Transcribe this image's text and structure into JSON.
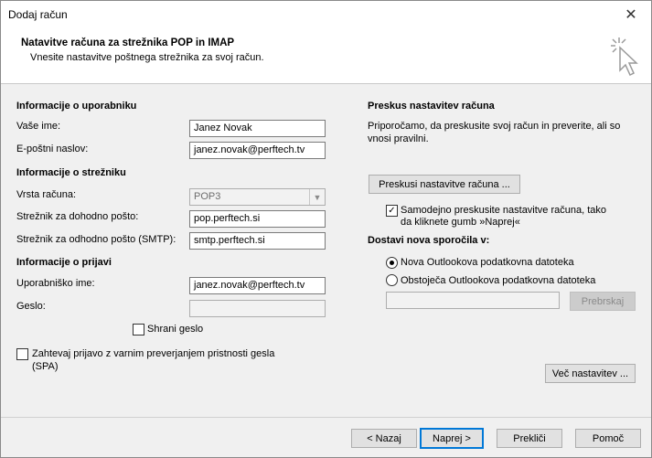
{
  "window": {
    "title": "Dodaj račun",
    "close_glyph": "✕"
  },
  "header": {
    "title": "Natavitve računa za strežnika POP in IMAP",
    "subtitle": "Vnesite nastavitve poštnega strežnika za svoj račun.",
    "icon": "wizard-cursor-icon"
  },
  "user_info": {
    "heading": "Informacije o uporabniku",
    "name_label": "Vaše ime:",
    "name_value": "Janez Novak",
    "email_label": "E-poštni naslov:",
    "email_value": "janez.novak@perftech.tv"
  },
  "server_info": {
    "heading": "Informacije o strežniku",
    "account_type_label": "Vrsta računa:",
    "account_type_value": "POP3",
    "incoming_label": "Strežnik za dohodno pošto:",
    "incoming_value": "pop.perftech.si",
    "outgoing_label": "Strežnik za odhodno pošto (SMTP):",
    "outgoing_value": "smtp.perftech.si"
  },
  "login_info": {
    "heading": "Informacije o prijavi",
    "username_label": "Uporabniško ime:",
    "username_value": "janez.novak@perftech.tv",
    "password_label": "Geslo:",
    "password_value": "",
    "remember_label": "Shrani geslo",
    "remember_checked": false,
    "spa_label_line1": "Zahtevaj prijavo z varnim preverjanjem pristnosti gesla",
    "spa_label_line2": "(SPA)",
    "spa_checked": false
  },
  "test_settings": {
    "heading": "Preskus nastavitev računa",
    "desc_line1": "Priporočamo, da preskusite svoj račun in preverite, ali so",
    "desc_line2": "vnosi pravilni.",
    "test_button": "Preskusi nastavitve računa ...",
    "auto_test_line1": "Samodejno preskusite nastavitve računa, tako",
    "auto_test_line2": "da kliknete gumb »Naprej«",
    "auto_test_checked": true,
    "checkmark": "✓"
  },
  "delivery": {
    "heading": "Dostavi nova sporočila v:",
    "option_new": "Nova Outlookova podatkovna datoteka",
    "option_existing": "Obstoječa Outlookova podatkovna datoteka",
    "selected": "new",
    "path_value": "",
    "browse_button": "Prebrskaj"
  },
  "more_settings_button": "Več nastavitev ...",
  "footer": {
    "back": "< Nazaj",
    "next": "Naprej >",
    "cancel": "Prekliči",
    "help": "Pomoč"
  },
  "colors": {
    "accent": "#0078d7",
    "header_bg": "#ffffff",
    "body_bg": "#f0f0f0"
  }
}
